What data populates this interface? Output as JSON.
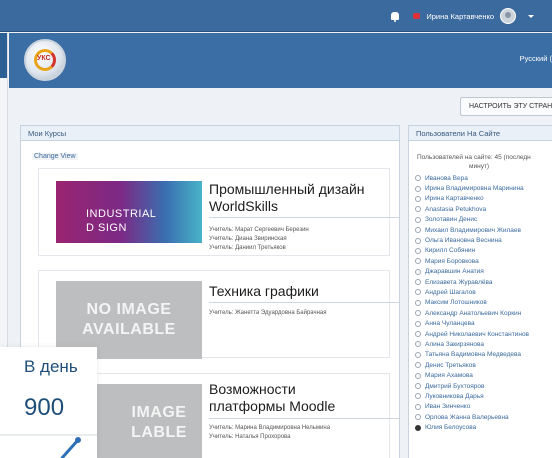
{
  "topbar": {
    "user_name": "Ирина Картавченко"
  },
  "banner": {
    "logo_text": "УКС",
    "language": "Русский ("
  },
  "customize_button": "НАСТРОИТЬ ЭТУ СТРАНИ",
  "my_courses": {
    "title": "Мои Курсы",
    "change_view": "Change View",
    "courses": [
      {
        "title_line1": "Промышленный дизайн",
        "title_line2": "WorldSkills",
        "image_line1": "INDUSTRIAL",
        "image_line2": "D SIGN",
        "teachers": [
          "Учитель: Марат Сергеевич Березин",
          "Учитель: Диана Звиринская",
          "Учитель: Даниил Третьяков"
        ]
      },
      {
        "title_line1": "Техника графики",
        "title_line2": "",
        "image_line1": "NO IMAGE",
        "image_line2": "AVAILABLE",
        "teachers": [
          "Учитель: Жанетта Эдуардовна Байрачная"
        ]
      },
      {
        "title_line1": "Возможности",
        "title_line2": "платформы Moodle",
        "image_line1": "IMAGE",
        "image_line2": "LABLE",
        "teachers": [
          "Учитель: Марина Владимировна Нельмина",
          "Учитель: Наталья Прохорова"
        ]
      }
    ]
  },
  "users_online": {
    "title": "Пользователи На Сайте",
    "note_line1": "Пользователей на сайте: 45 (последн",
    "note_line2": "минут)",
    "users": [
      "Иванова Вера",
      "Ирина Владимировна Маринина",
      "Ирина Картавченко",
      "Anastasia Petukhova",
      "Золотавин Денис",
      "Михаил Владимирович Жилаев",
      "Ольга Ивановна Веснина",
      "Кирилл Собянин",
      "Мария Боровкова",
      "Джаравшин Анатия",
      "Елизавета Журавлёва",
      "Андрей Шагалов",
      "Максим Лотошников",
      "Александр Анатольевич Коркин",
      "Анна Чуланцева",
      "Андрей Николаевич Константинов",
      "Алина Закирзянова",
      "Татьяна Вадимовна Медведева",
      "Денис Третьяков",
      "Мария Ахамова",
      "Дмитрий Бухтояров",
      "Луковникова Дарья",
      "Иван Зинченко",
      "Орлова Жанна Валерьевна",
      "Юлия Белоусова"
    ]
  },
  "stat_widget": {
    "label": "В день",
    "value": "900",
    "accent": "#1f4e79",
    "line_color": "#2f6fb5"
  }
}
